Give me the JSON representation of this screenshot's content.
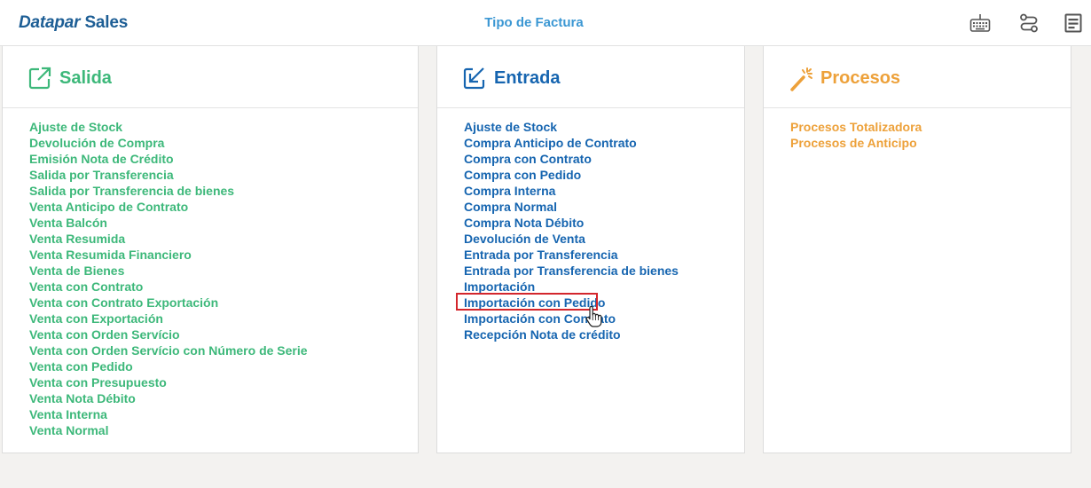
{
  "header": {
    "brand_part1": "Datapar",
    "brand_part2": "Sales",
    "title": "Tipo de Factura",
    "icons": [
      "keyboard-icon",
      "routes-icon",
      "form-icon"
    ]
  },
  "colors": {
    "salida": "#3db87a",
    "entrada": "#1665b0",
    "procesos": "#eda13a",
    "brand": "#1d5e95",
    "title": "#3b97d3",
    "highlight": "#d3262c"
  },
  "panels": {
    "salida": {
      "title": "Salida",
      "icon": "external-link-icon",
      "items": [
        "Ajuste de Stock",
        "Devolución de Compra",
        "Emisión Nota de Crédito",
        "Salida por Transferencia",
        "Salida por Transferencia de bienes",
        "Venta Anticipo de Contrato",
        "Venta Balcón",
        "Venta Resumida",
        "Venta Resumida Financiero",
        "Venta de Bienes",
        "Venta con Contrato",
        "Venta con Contrato Exportación",
        "Venta con Exportación",
        "Venta con Orden Servício",
        "Venta con Orden Servício con Número de Serie",
        "Venta con Pedido",
        "Venta con Presupuesto",
        "Venta Nota Débito",
        "Venta Interna",
        "Venta Normal"
      ]
    },
    "entrada": {
      "title": "Entrada",
      "icon": "arrow-in-box-icon",
      "items": [
        "Ajuste de Stock",
        "Compra Anticipo de Contrato",
        "Compra con Contrato",
        "Compra con Pedido",
        "Compra Interna",
        "Compra Normal",
        "Compra Nota Débito",
        "Devolución de Venta",
        "Entrada por Transferencia",
        "Entrada por Transferencia de bienes",
        "Importación",
        "Importación con Pedido",
        "Importación con Contrato",
        "Recepción Nota de crédito"
      ],
      "highlighted_index": 11
    },
    "procesos": {
      "title": "Procesos",
      "icon": "magic-wand-icon",
      "items": [
        "Procesos Totalizadora",
        "Procesos de Anticipo"
      ]
    }
  }
}
